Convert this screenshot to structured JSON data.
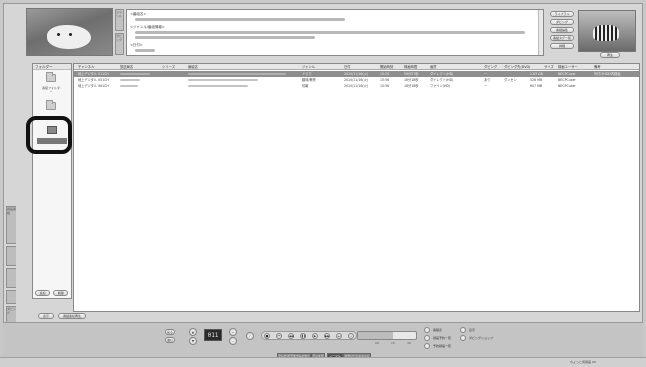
{
  "vertical_tabs": [
    "録画番組",
    "",
    "",
    "",
    "ダビング"
  ],
  "info_tabs": [
    "ジャンル",
    "ダビング"
  ],
  "info": {
    "program_name_label": "<番組名>",
    "content_label": "<ジャンル/番組情報>",
    "date_label": "<日付>"
  },
  "right_buttons": [
    "ライブラリ",
    "ダビング",
    "番組編集",
    "番組タグ一覧",
    "詳細"
  ],
  "right_thumb_button": "再生",
  "folder": {
    "header": "フォルダー",
    "items": [
      "",
      "番組フォルダー",
      ""
    ],
    "selected_label": "",
    "bottom_buttons": [
      "追加",
      "削除"
    ],
    "tab_buttons": [
      "表示",
      "番組連続再生"
    ]
  },
  "list": {
    "headers": [
      "チャンネル",
      "放送局名",
      "シリーズ",
      "番組名",
      "ジャンル",
      "日付",
      "開始時刻",
      "録画時間",
      "画質",
      "ダビング",
      "ダビング先(DVD)",
      "サイズ",
      "録画ユーザー",
      "備考"
    ],
    "rows": [
      {
        "channel": "地上デジタル 011CH",
        "genre": "ドラマ",
        "date": "2010/11/16(火)",
        "start": "15:25",
        "duration": "59分57秒",
        "quality": "ダイレクト(HD)",
        "dub": "ー",
        "dubdest": "",
        "size": "2.83 GB",
        "user": "NECPCuser",
        "note": "外付けHDD内録画"
      },
      {
        "channel": "地上デジタル 051CH",
        "genre": "趣味/教育",
        "date": "2010/11/16(火)",
        "start": "15:56",
        "duration": "16分18秒",
        "quality": "ダイレクト(HD)",
        "dub": "あり",
        "dubdest": "ダンセン",
        "size": "526 MB",
        "user": "NECPCuser",
        "note": ""
      },
      {
        "channel": "地上デジタル 061CH",
        "genre": "情報",
        "date": "2010/11/16(火)",
        "start": "15:56",
        "duration": "16分18秒",
        "quality": "ファイン(HD)",
        "dub": "ー",
        "dubdest": "",
        "size": "607 MB",
        "user": "NECPCuser",
        "note": ""
      }
    ]
  },
  "player": {
    "channel_display": "011",
    "left_buttons": [
      "戻る",
      "進む"
    ],
    "seek_marks": [
      "00",
      "15",
      "30"
    ],
    "seek_progress": 0.6,
    "right_labels": [
      "番組表",
      "表示",
      "録画予約一覧",
      "ダビングショップ",
      "予約録画一覧"
    ],
    "mode_tabs": [
      "テレビ/ビデオプレイヤー",
      "ディスク",
      "ノーマル",
      "スクリーンショット"
    ]
  },
  "status_text": "ちょっと見録画 00"
}
